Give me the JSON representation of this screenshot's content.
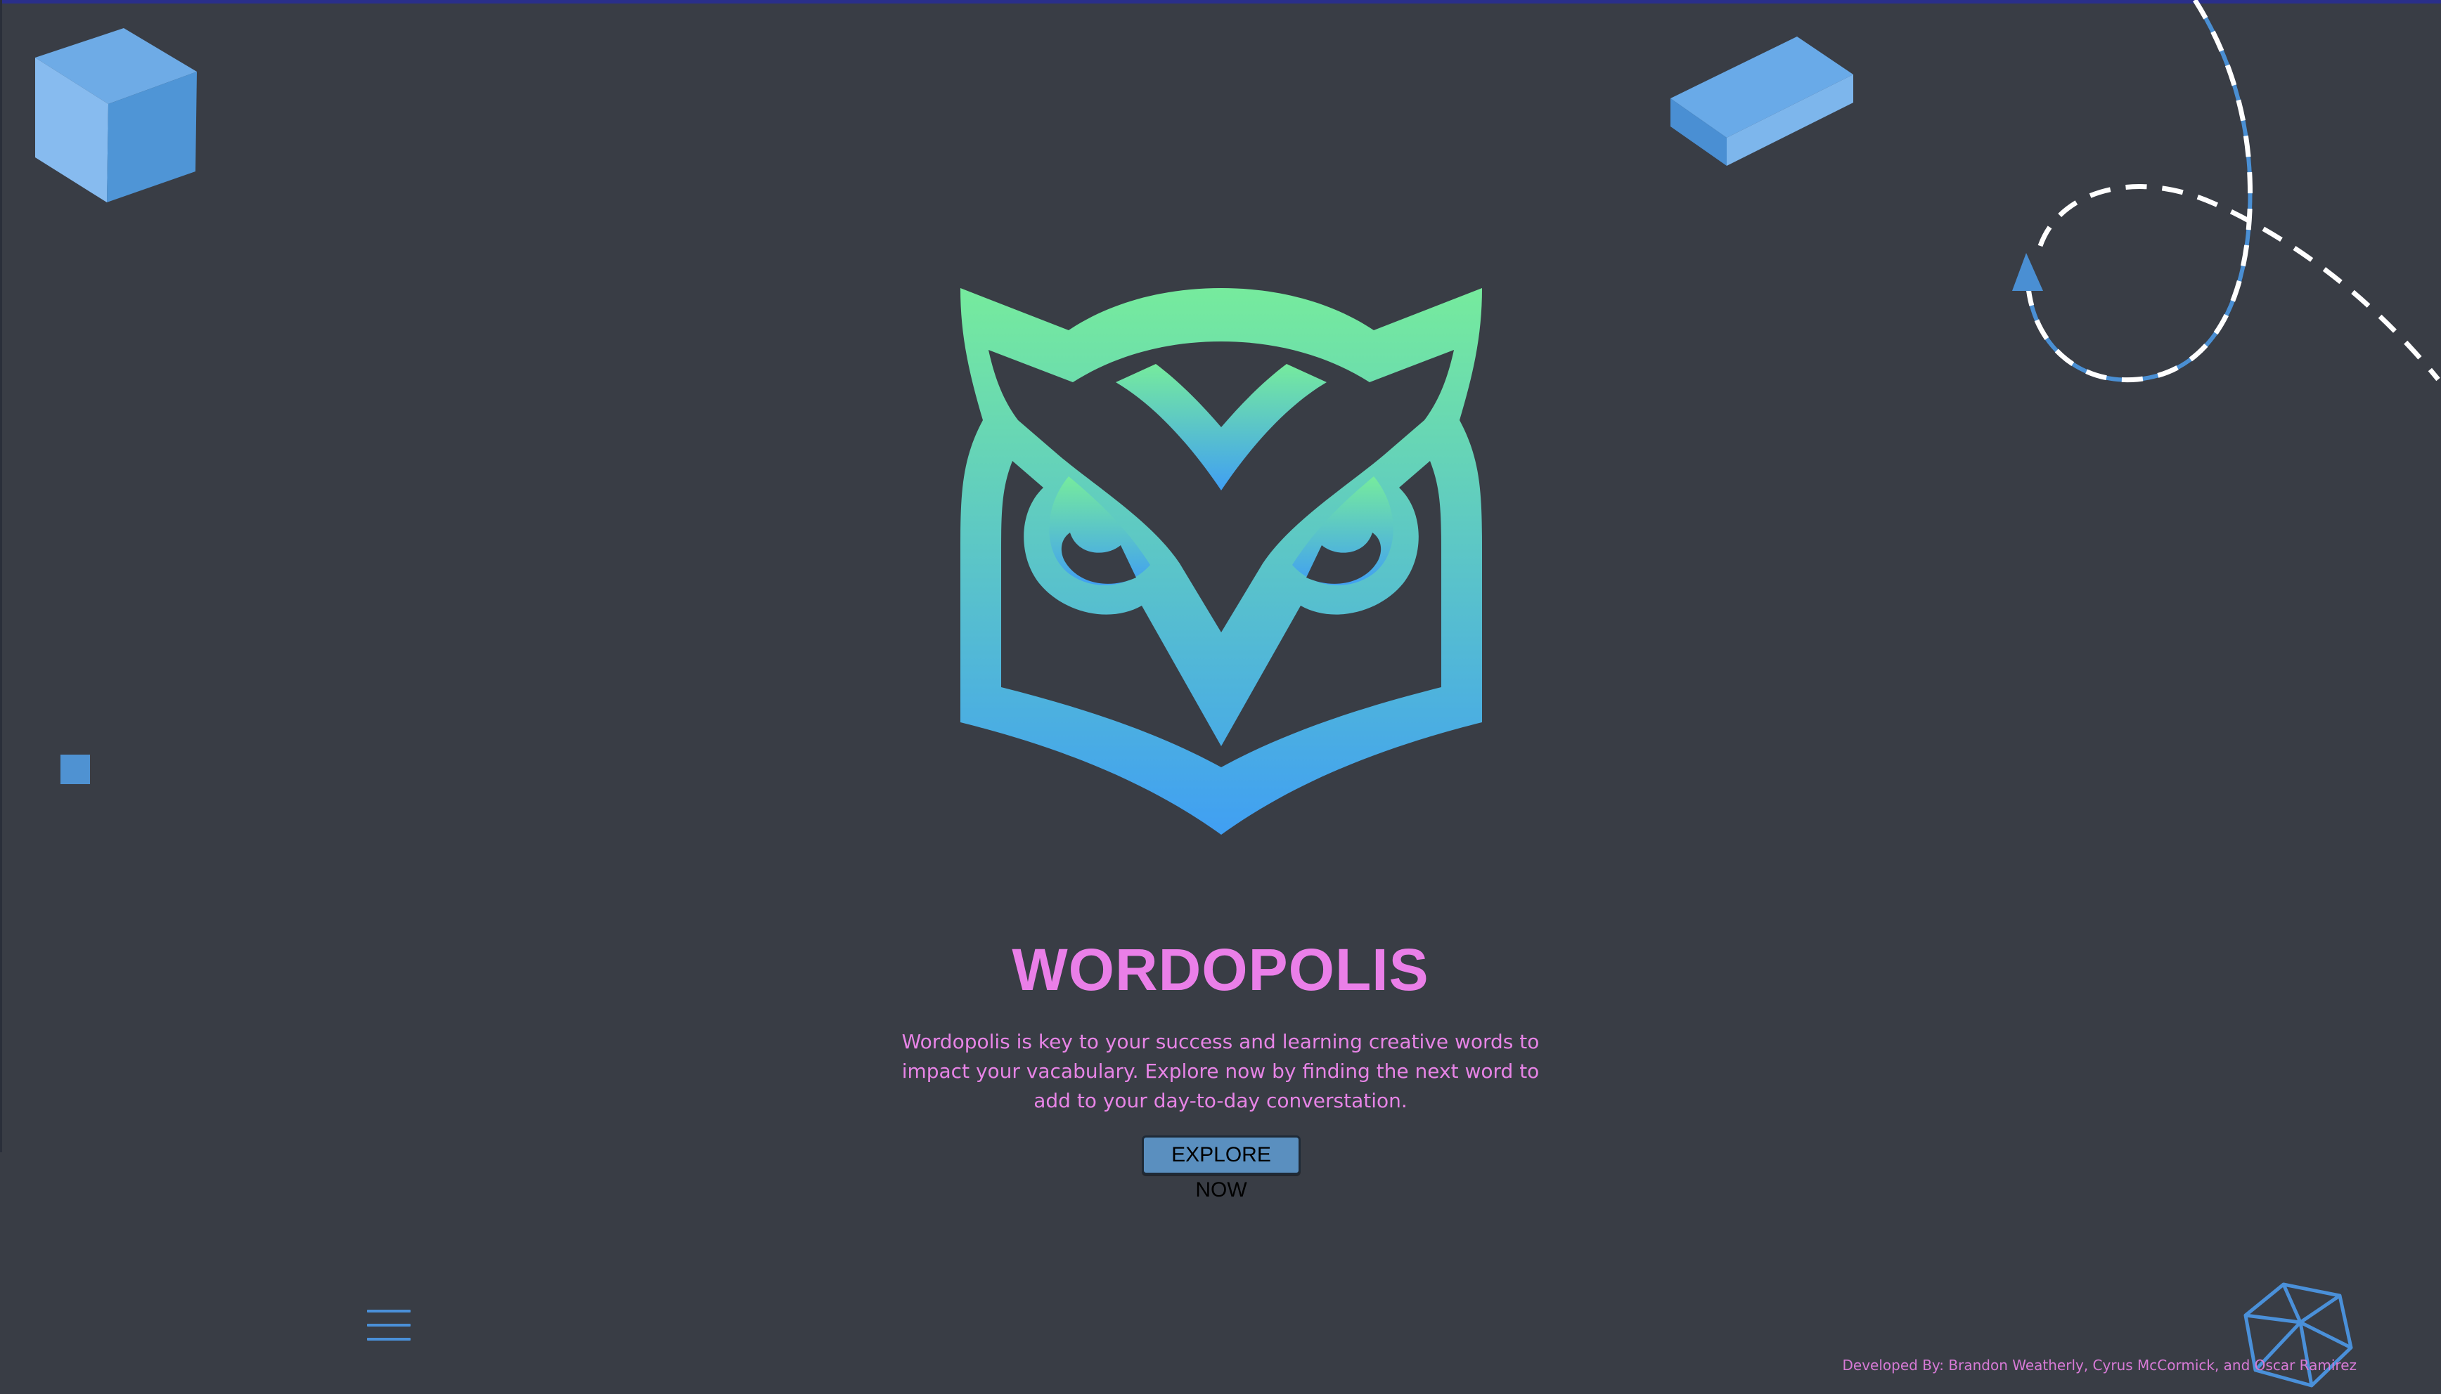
{
  "hero": {
    "title": "WORDOPOLIS",
    "description": "Wordopolis is key to your success and learning creative words to impact your vacabulary. Explore now by finding the next word to add to your day-to-day converstation.",
    "cta_label": "EXPLORE NOW"
  },
  "footer": {
    "credits": "Developed By: Brandon Weatherly, Cyrus McCormick, and Oscar Ramirez"
  },
  "icons": {
    "logo": "owl-logo-icon",
    "menu": "hamburger-menu-icon",
    "cube_top_left": "cube-icon",
    "block_top_right": "rectangular-block-icon",
    "square_left": "small-square-icon",
    "wireframe_cube": "wireframe-cube-icon",
    "flight_path": "dashed-loop-path-with-arrow"
  },
  "colors": {
    "background": "#393d45",
    "title": "#ea7fe8",
    "description": "#e784e6",
    "credits": "#d77ad6",
    "accent_blue": "#4a90d9",
    "logo_gradient_top": "#76eb9d",
    "logo_gradient_bottom": "#409ff3",
    "button_bg": "#5a8fbf"
  }
}
